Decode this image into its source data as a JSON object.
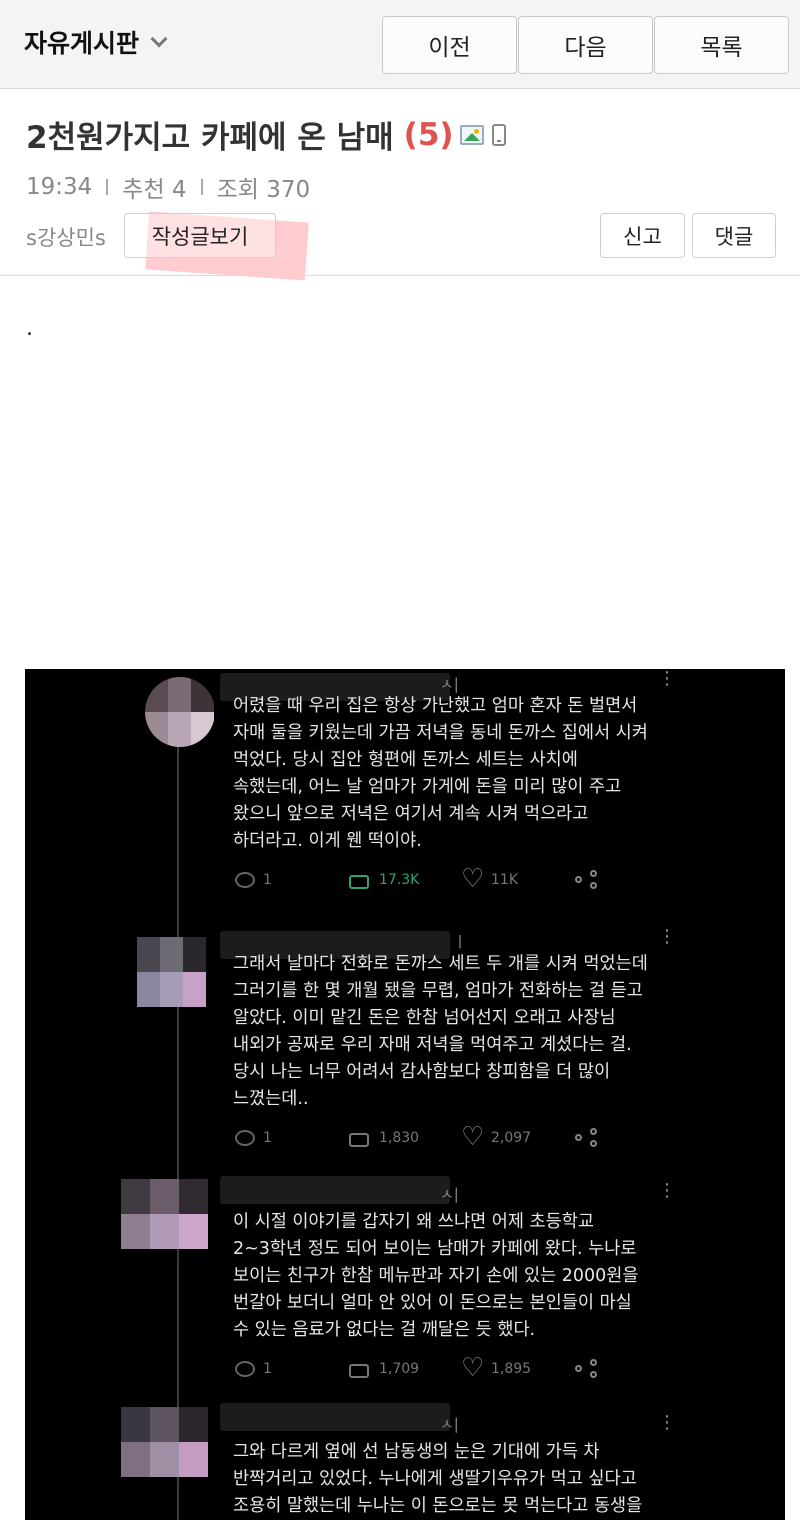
{
  "header": {
    "board_title": "자유게시판",
    "prev_label": "이전",
    "next_label": "다음",
    "list_label": "목록"
  },
  "post": {
    "title": "2천원가지고 카페에 온 남매",
    "comment_count": "(5)",
    "time": "19:34",
    "recommend": "추천 4",
    "views": "조회 370",
    "author": "s강상민s",
    "author_posts_label": "작성글보기",
    "report_label": "신고",
    "comment_label": "댓글",
    "body_text": "."
  },
  "screenshot": {
    "tweets": [
      {
        "name_suffix": "ㅅ|",
        "text": "어렸을 때 우리 집은 항상 가난했고 엄마 혼자 돈 벌면서\n자매 둘을 키웠는데 가끔 저녁을 동네 돈까스 집에서 시켜\n먹었다. 당시 집안 형편에 돈까스 세트는 사치에\n속했는데, 어느 날 엄마가 가게에 돈을 미리 많이 주고\n왔으니 앞으로 저녁은 여기서 계속 시켜 먹으라고\n하더라고. 이게 웬 떡이야.",
        "replies": "1",
        "retweets": "17.3K",
        "likes": "11K"
      },
      {
        "name_suffix": "ㅣ",
        "text": "그래서 날마다 전화로 돈까스 세트 두 개를 시켜 먹었는데\n그러기를 한 몇 개월 됐을 무렵, 엄마가 전화하는 걸 듣고\n알았다. 이미 맡긴 돈은 한참 넘어선지 오래고 사장님\n내외가 공짜로 우리 자매 저녁을 먹여주고 계셨다는 걸.\n당시 나는 너무 어려서 감사함보다 창피함을 더 많이\n느꼈는데..",
        "replies": "1",
        "retweets": "1,830",
        "likes": "2,097"
      },
      {
        "name_suffix": "ㅅ|",
        "text": "이 시절 이야기를 갑자기 왜 쓰냐면 어제 초등학교\n2~3학년 정도 되어 보이는 남매가 카페에 왔다. 누나로\n보이는 친구가 한참 메뉴판과 자기 손에 있는 2000원을\n번갈아 보더니 얼마 안 있어 이 돈으로는 본인들이 마실\n수 있는 음료가 없다는 걸 깨달은 듯 했다.",
        "replies": "1",
        "retweets": "1,709",
        "likes": "1,895"
      },
      {
        "name_suffix": "ㅅ|",
        "text": "그와 다르게 옆에 선 남동생의 눈은 기대에 가득 차\n반짝거리고 있었다. 누나에게 생딸기우유가 먹고 싶다고\n조용히 말했는데 누나는 이 돈으로는 못 먹는다고 동생을",
        "replies": "",
        "retweets": "",
        "likes": ""
      }
    ]
  }
}
